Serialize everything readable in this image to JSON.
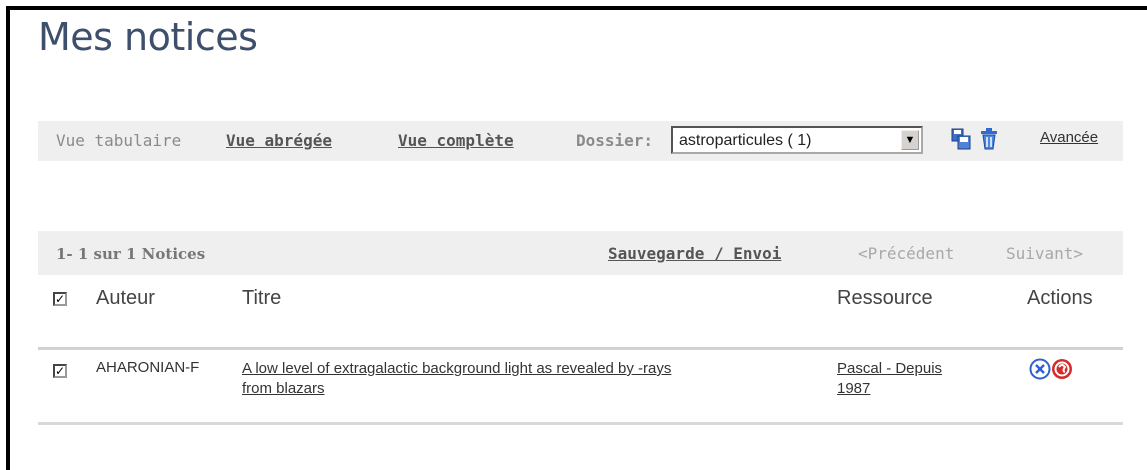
{
  "page": {
    "title": "Mes notices"
  },
  "toolbar": {
    "view_tabular": "Vue tabulaire",
    "view_short": "Vue abrégée",
    "view_full": "Vue complète",
    "folder_label": "Dossier:",
    "folder_value": "astroparticules ( 1)",
    "advanced_link": "Avancée"
  },
  "results": {
    "count_text": "1- 1 sur 1 Notices",
    "save_send": "Sauvegarde / Envoi",
    "previous": "<Précédent",
    "next": "Suivant>"
  },
  "table": {
    "headers": {
      "author": "Auteur",
      "title": "Titre",
      "resource": "Ressource",
      "actions": "Actions"
    },
    "rows": [
      {
        "author": "AHARONIAN-F",
        "title_line1": "A low level of extragalactic background light as revealed by -rays",
        "title_line2": "from blazars",
        "resource_line1": "Pascal - Depuis",
        "resource_line2": "1987"
      }
    ]
  },
  "icons": {
    "save_folder": "copy-folder-icon",
    "delete_folder": "trash-icon",
    "remove_action": "remove-circle-icon",
    "sfx_action": "sfx-link-icon"
  },
  "colors": {
    "title": "#3d4f6a",
    "bar_bg": "#efefef",
    "remove_blue": "#2f5fd0",
    "sfx_red": "#d42a2a"
  }
}
